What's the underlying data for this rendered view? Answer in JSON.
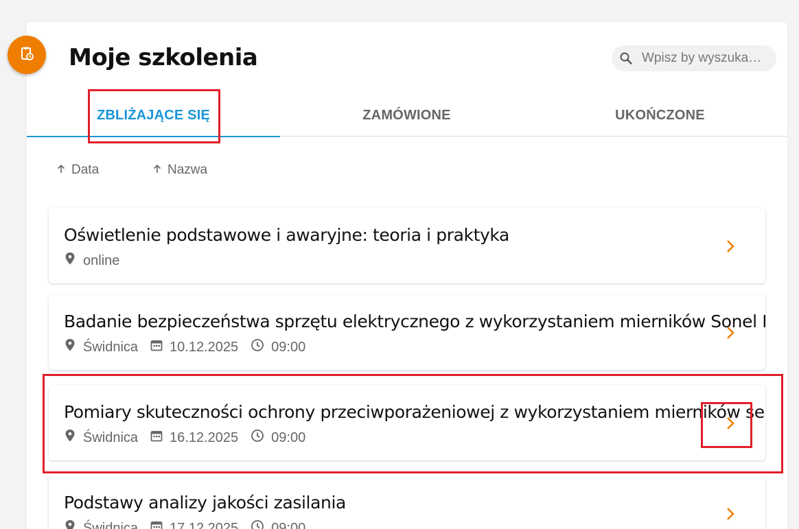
{
  "header": {
    "title": "Moje szkolenia",
    "fab_icon": "clipboard-clock-icon",
    "accent_color": "#ef7d00"
  },
  "search": {
    "placeholder": "Wpisz by wyszuka…",
    "value": ""
  },
  "tabs": [
    {
      "label": "ZBLIŻAJĄCE SIĘ",
      "active": true
    },
    {
      "label": "ZAMÓWIONE",
      "active": false
    },
    {
      "label": "UKOŃCZONE",
      "active": false
    }
  ],
  "sort": [
    {
      "label": "Data",
      "icon": "arrow-up-icon"
    },
    {
      "label": "Nazwa",
      "icon": "arrow-up-icon"
    }
  ],
  "trainings": [
    {
      "title": "Oświetlenie podstawowe i awaryjne: teoria i praktyka",
      "location": "online",
      "date": "",
      "time": ""
    },
    {
      "title": "Badanie bezpieczeństwa sprzętu elektrycznego z wykorzystaniem mierników Sonel PAT",
      "location": "Świdnica",
      "date": "10.12.2025",
      "time": "09:00"
    },
    {
      "title": "Pomiary skuteczności ochrony przeciwporażeniowej z wykorzystaniem mierników serii Sonel",
      "location": "Świdnica",
      "date": "16.12.2025",
      "time": "09:00"
    },
    {
      "title": "Podstawy analizy jakości zasilania",
      "location": "Świdnica",
      "date": "17.12.2025",
      "time": "09:00"
    }
  ],
  "colors": {
    "tab_active": "#1a95d6",
    "chevron": "#ef7d00",
    "highlight": "#e01f2a"
  }
}
